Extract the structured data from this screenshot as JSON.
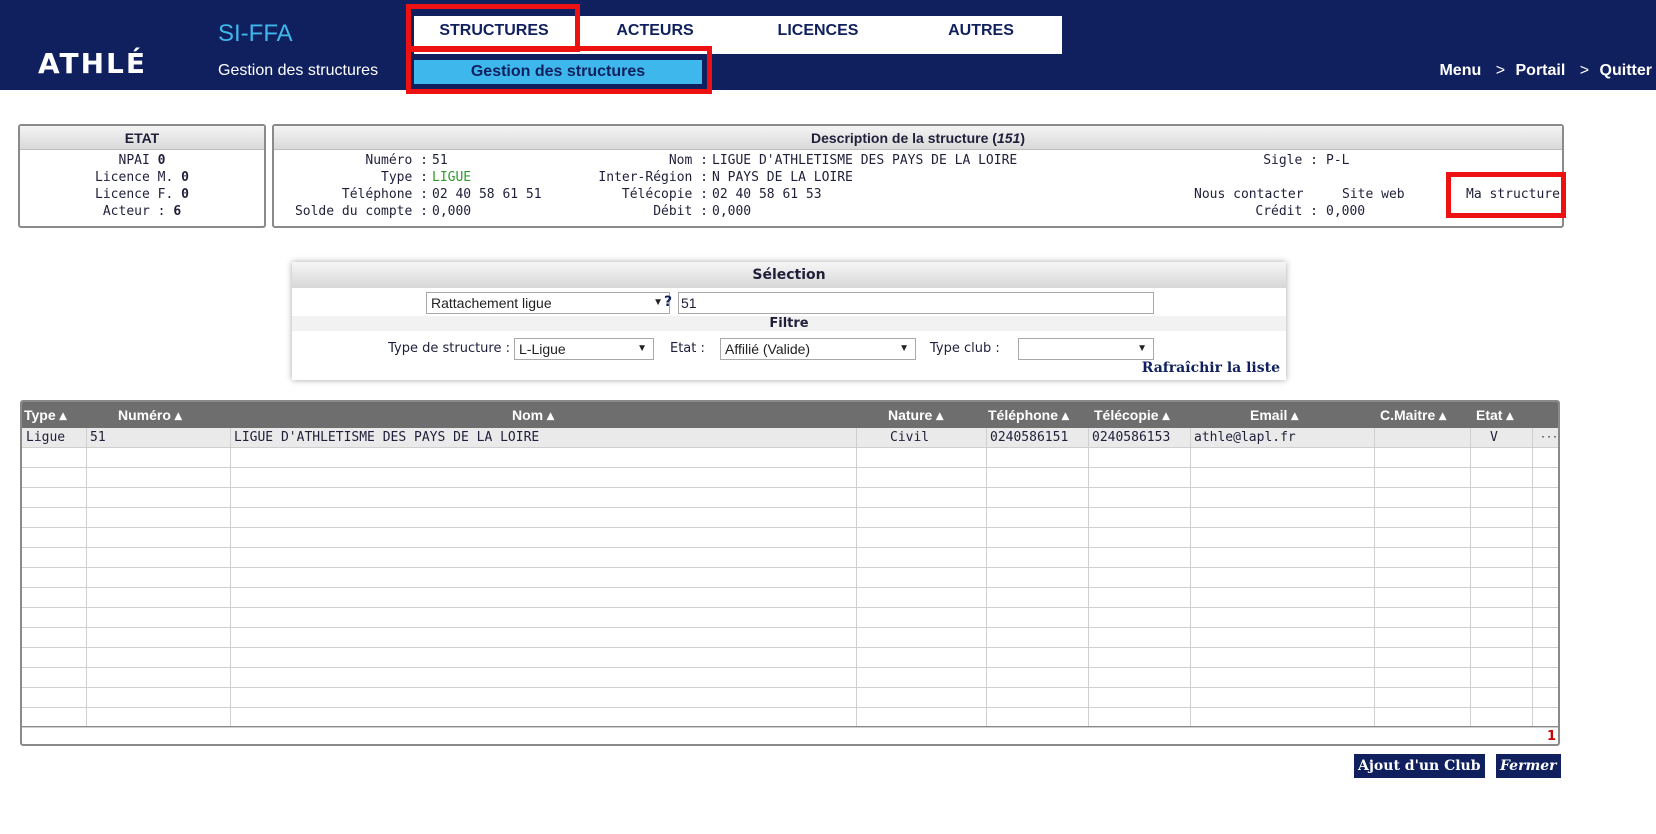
{
  "header": {
    "logo_text": "ATHLÉ",
    "app_title": "SI-FFA",
    "app_subtitle": "Gestion des structures",
    "nav_tabs": [
      "STRUCTURES",
      "ACTEURS",
      "LICENCES",
      "AUTRES"
    ],
    "subnav_label": "Gestion des structures",
    "links": {
      "menu": "Menu",
      "portail": "Portail",
      "quitter": "Quitter",
      "sep": ">"
    }
  },
  "etat": {
    "title": "ETAT",
    "npai_label": "NPAI",
    "npai_value": "0",
    "licence_m_label": "Licence M.",
    "licence_m_value": "0",
    "licence_f_label": "Licence F.",
    "licence_f_value": "0",
    "acteur_label": "Acteur :",
    "acteur_value": "6"
  },
  "description": {
    "title": "Description de la structure",
    "title_num": "151",
    "numero_label": "Numéro :",
    "numero": "51",
    "type_label": "Type :",
    "type": "LIGUE",
    "telephone_label": "Téléphone :",
    "telephone": "02 40 58 61 51",
    "solde_label": "Solde du compte :",
    "solde": "0,000",
    "nom_label": "Nom :",
    "nom": "LIGUE D'ATHLETISME DES PAYS DE LA LOIRE",
    "interregion_label": "Inter-Région :",
    "interregion": "N PAYS DE LA LOIRE",
    "telecopie_label": "Télécopie :",
    "telecopie": "02 40 58 61 53",
    "debit_label": "Débit :",
    "debit": "0,000",
    "sigle_label": "Sigle :",
    "sigle": "P-L",
    "nous_contacter": "Nous contacter",
    "site_web": "Site web",
    "ma_structure": "Ma structure",
    "credit_label": "Crédit :",
    "credit": "0,000"
  },
  "selection": {
    "title": "Sélection",
    "rattachement": "Rattachement ligue",
    "question": "?",
    "value": "51",
    "filtre_title": "Filtre",
    "type_structure_label": "Type de structure :",
    "type_structure": "L-Ligue",
    "etat_label": "Etat :",
    "etat": "Affilié (Valide)",
    "type_club_label": "Type club :",
    "type_club": "",
    "refresh": "Rafraîchir la liste"
  },
  "table": {
    "columns": [
      "Type ▴",
      "Numéro ▴",
      "Nom ▴",
      "Nature ▴",
      "Téléphone ▴",
      "Télécopie ▴",
      "Email ▴",
      "C.Maitre ▴",
      "Etat ▴"
    ],
    "rows": [
      {
        "type": "Ligue",
        "numero": "51",
        "nom": "LIGUE D'ATHLETISME DES PAYS DE LA LOIRE",
        "nature": "Civil",
        "telephone": "0240586151",
        "telecopie": "0240586153",
        "email": "athle@lapl.fr",
        "cmaitre": "",
        "etat": "V",
        "more": "···"
      }
    ],
    "count": "1"
  },
  "buttons": {
    "ajout_club": "Ajout d'un Club",
    "fermer": "Fermer"
  }
}
